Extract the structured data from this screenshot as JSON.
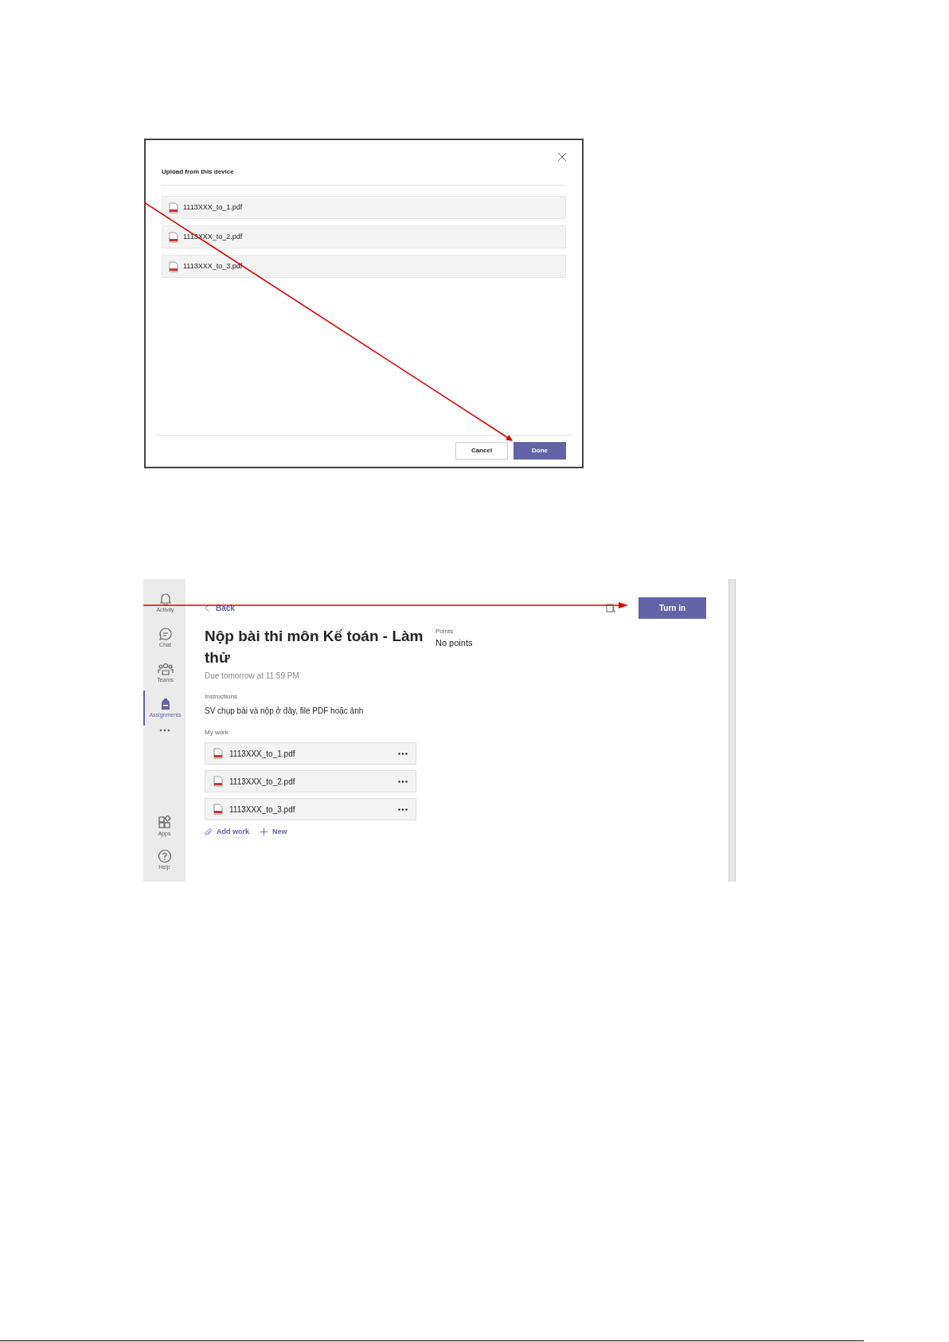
{
  "upload_dialog": {
    "title": "Upload from this device",
    "files": [
      {
        "name": "1113XXX_to_1.pdf"
      },
      {
        "name": "1113XXX_to_2.pdf"
      },
      {
        "name": "1113XXX_to_3.pdf"
      }
    ],
    "cancel": "Cancel",
    "done": "Done"
  },
  "assignment_screen": {
    "rail": [
      {
        "label": "Activity",
        "selected": false
      },
      {
        "label": "Chat",
        "selected": false
      },
      {
        "label": "Teams",
        "selected": false
      },
      {
        "label": "Assignments",
        "selected": true
      }
    ],
    "rail_bottom": [
      {
        "label": "Apps"
      },
      {
        "label": "Help"
      }
    ],
    "back": "Back",
    "turn_in": "Turn in",
    "title": "Nộp bài thi môn Kế toán - Làm thử",
    "due": "Due tomorrow at 11:59 PM",
    "instructions_label": "Instructions",
    "instructions": "SV chụp bài và nộp ở đây, file PDF hoặc ảnh",
    "my_work_label": "My work",
    "files": [
      {
        "name": "1113XXX_to_1.pdf"
      },
      {
        "name": "1113XXX_to_2.pdf"
      },
      {
        "name": "1113XXX_to_3.pdf"
      }
    ],
    "add_work": "Add work",
    "new": "New",
    "points_label": "Points",
    "points": "No points"
  }
}
